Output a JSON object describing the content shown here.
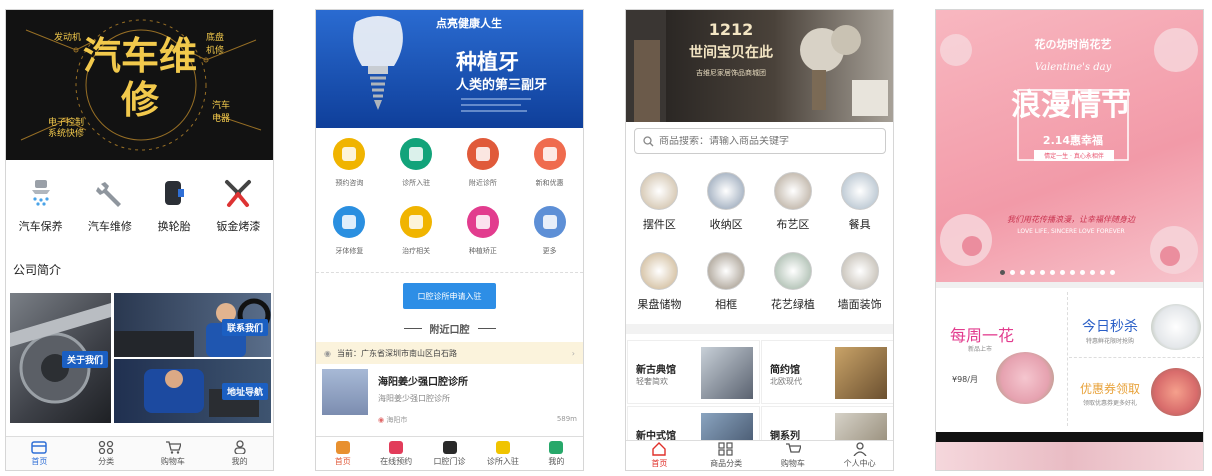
{
  "phone1": {
    "banner": {
      "title": "汽车维修",
      "tags": [
        "发动机",
        "底盘机修",
        "汽车电器",
        "电子控制系统快修"
      ]
    },
    "categories": [
      {
        "label": "汽车保养",
        "icon": "shower-icon"
      },
      {
        "label": "汽车维修",
        "icon": "wrench-icon"
      },
      {
        "label": "换轮胎",
        "icon": "tire-icon"
      },
      {
        "label": "钣金烤漆",
        "icon": "pliers-icon"
      }
    ],
    "section_title": "公司简介",
    "photo_tags": {
      "about": "关于我们",
      "contact": "联系我们",
      "map": "地址导航"
    },
    "tabs": [
      {
        "label": "首页",
        "icon": "shop-icon"
      },
      {
        "label": "分类",
        "icon": "grid-icon"
      },
      {
        "label": "购物车",
        "icon": "cart-icon"
      },
      {
        "label": "我的",
        "icon": "user-icon"
      }
    ]
  },
  "phone2": {
    "banner": {
      "top": "点亮健康人生",
      "title": "种植牙",
      "subtitle": "人类的第三副牙"
    },
    "services_row1": [
      "预约咨询",
      "诊所入驻",
      "附近诊所",
      "新和优惠"
    ],
    "services_row2": [
      "牙体修复",
      "治疗相关",
      "种植矫正",
      "更多"
    ],
    "apply_button": "口腔诊所申请入驻",
    "nearby_title": "附近口腔",
    "location": "当前：广东省深圳市南山区白石路",
    "clinic": {
      "name": "海阳姜少强口腔诊所",
      "desc": "海阳姜少强口腔诊所",
      "city": "海阳市",
      "distance": "589m"
    },
    "tabs": [
      {
        "label": "首页"
      },
      {
        "label": "在线预约"
      },
      {
        "label": "口腔门诊"
      },
      {
        "label": "诊所入驻"
      },
      {
        "label": "我的"
      }
    ],
    "colors": {
      "row1": [
        "#f0b400",
        "#12a37a",
        "#e05a3a",
        "#ef6b4e"
      ],
      "row2": [
        "#2a8fe0",
        "#f0b400",
        "#e23c8e",
        "#5d8fd6"
      ]
    }
  },
  "phone3": {
    "banner": {
      "line1": "1212",
      "line2": "世间宝贝在此",
      "line3": "吉维尼家居饰品商城团"
    },
    "search_placeholder": "商品搜索：请输入商品关键字",
    "categories_row1": [
      "摆件区",
      "收纳区",
      "布艺区",
      "餐具"
    ],
    "categories_row2": [
      "果盘储物",
      "相框",
      "花艺绿植",
      "墙面装饰"
    ],
    "halls": [
      {
        "title": "新古典馆",
        "sub": "轻奢简欢"
      },
      {
        "title": "简约馆",
        "sub": "北欧现代"
      },
      {
        "title": "新中式馆",
        "sub": ""
      },
      {
        "title": "铜系列",
        "sub": ""
      }
    ],
    "tabs": [
      {
        "label": "首页"
      },
      {
        "label": "商品分类"
      },
      {
        "label": "购物车"
      },
      {
        "label": "个人中心"
      }
    ]
  },
  "phone4": {
    "banner": {
      "top": "花の坊时尚花艺",
      "script": "Valentine's day",
      "title": "浪漫情节",
      "sub": "2.14惠幸福",
      "note": "情定一生 · 真心永相伴",
      "verse": "我们用花传播浪漫，让幸福伴随身边",
      "love": "LOVE LIFE, SINCERE LOVE FOREVER"
    },
    "weekly": {
      "title": "每周一花",
      "sub": "新品上市",
      "price": "¥98/月"
    },
    "flash": {
      "title": "今日秒杀",
      "sub": "特惠鲜花限时抢购"
    },
    "coupon": {
      "title": "优惠券领取",
      "sub": "领取优惠券更多好礼"
    }
  }
}
